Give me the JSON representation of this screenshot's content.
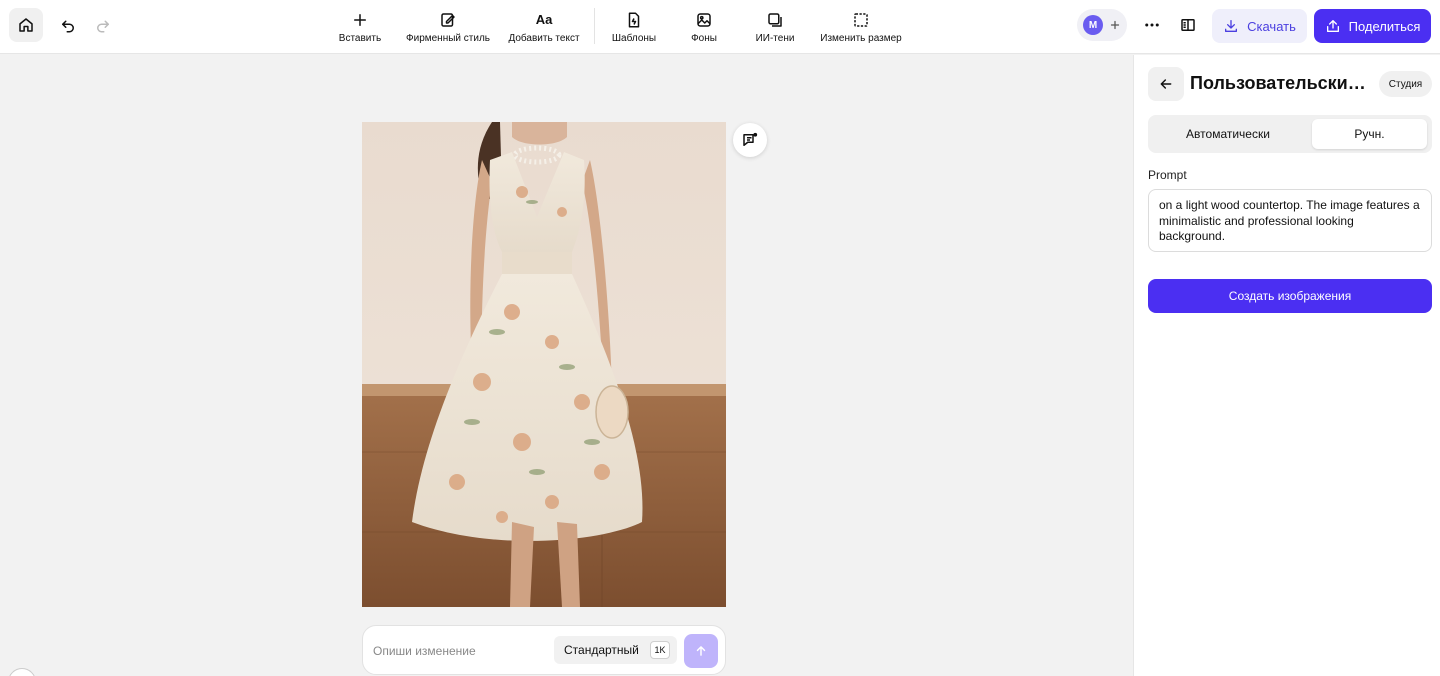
{
  "toolbar": {
    "tools": [
      {
        "label": "Вставить",
        "icon": "plus-icon"
      },
      {
        "label": "Фирменный стиль",
        "icon": "brand-style-icon"
      },
      {
        "label": "Добавить текст",
        "icon": "text-icon"
      },
      {
        "label": "Шаблоны",
        "icon": "templates-icon"
      },
      {
        "label": "Фоны",
        "icon": "backgrounds-icon"
      },
      {
        "label": "ИИ-тени",
        "icon": "ai-shadows-icon"
      },
      {
        "label": "Изменить размер",
        "icon": "resize-icon"
      }
    ],
    "text_tool_glyph": "Aa",
    "avatar_initial": "M",
    "download_label": "Скачать",
    "share_label": "Поделиться"
  },
  "canvas": {
    "edit_placeholder": "Опиши изменение",
    "quality_label": "Стандартный",
    "resolution_badge": "1K"
  },
  "panel": {
    "title": "Пользовательский ...",
    "studio_badge": "Студия",
    "mode_tabs": [
      {
        "label": "Автоматически",
        "active": false
      },
      {
        "label": "Ручн.",
        "active": true
      }
    ],
    "prompt_label": "Prompt",
    "prompt_value": "on a light wood countertop. The image features a minimalistic and professional looking background.",
    "create_button": "Создать изображения"
  },
  "colors": {
    "accent": "#4b2ff2",
    "accent_soft": "#efeffb",
    "send_disabled": "#bfb4fb"
  }
}
